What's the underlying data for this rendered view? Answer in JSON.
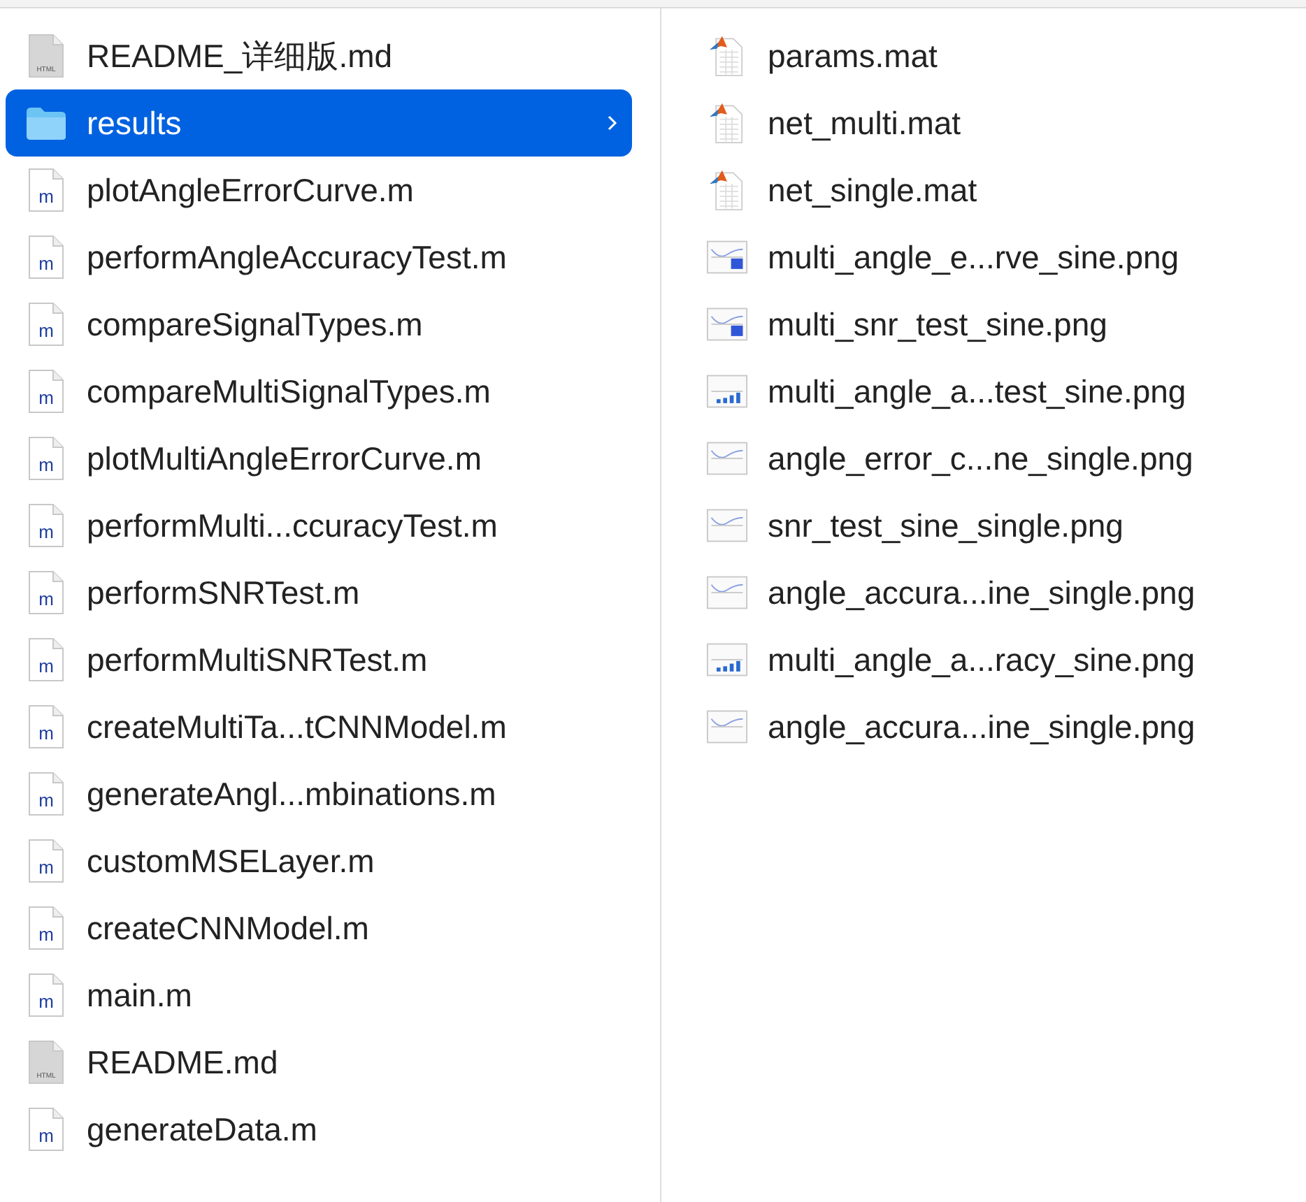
{
  "columns": [
    {
      "items": [
        {
          "name": "README_详细版.md",
          "kind": "html",
          "icon_label": "HTML",
          "selected": false
        },
        {
          "name": "results",
          "kind": "folder",
          "selected": true,
          "expandable": true
        },
        {
          "name": "plotAngleErrorCurve.m",
          "kind": "m",
          "icon_label": "m",
          "selected": false
        },
        {
          "name": "performAngleAccuracyTest.m",
          "kind": "m",
          "icon_label": "m",
          "selected": false
        },
        {
          "name": "compareSignalTypes.m",
          "kind": "m",
          "icon_label": "m",
          "selected": false
        },
        {
          "name": "compareMultiSignalTypes.m",
          "kind": "m",
          "icon_label": "m",
          "selected": false
        },
        {
          "name": "plotMultiAngleErrorCurve.m",
          "kind": "m",
          "icon_label": "m",
          "selected": false
        },
        {
          "name": "performMulti...ccuracyTest.m",
          "kind": "m",
          "icon_label": "m",
          "selected": false
        },
        {
          "name": "performSNRTest.m",
          "kind": "m",
          "icon_label": "m",
          "selected": false
        },
        {
          "name": "performMultiSNRTest.m",
          "kind": "m",
          "icon_label": "m",
          "selected": false
        },
        {
          "name": "createMultiTa...tCNNModel.m",
          "kind": "m",
          "icon_label": "m",
          "selected": false
        },
        {
          "name": "generateAngl...mbinations.m",
          "kind": "m",
          "icon_label": "m",
          "selected": false
        },
        {
          "name": "customMSELayer.m",
          "kind": "m",
          "icon_label": "m",
          "selected": false
        },
        {
          "name": "createCNNModel.m",
          "kind": "m",
          "icon_label": "m",
          "selected": false
        },
        {
          "name": "main.m",
          "kind": "m",
          "icon_label": "m",
          "selected": false
        },
        {
          "name": "README.md",
          "kind": "html",
          "icon_label": "HTML",
          "selected": false
        },
        {
          "name": "generateData.m",
          "kind": "m",
          "icon_label": "m",
          "selected": false
        }
      ]
    },
    {
      "items": [
        {
          "name": "params.mat",
          "kind": "mat",
          "selected": false
        },
        {
          "name": "net_multi.mat",
          "kind": "mat",
          "selected": false
        },
        {
          "name": "net_single.mat",
          "kind": "mat",
          "selected": false
        },
        {
          "name": "multi_angle_e...rve_sine.png",
          "kind": "heatmap",
          "selected": false
        },
        {
          "name": "multi_snr_test_sine.png",
          "kind": "heatmap",
          "selected": false
        },
        {
          "name": "multi_angle_a...test_sine.png",
          "kind": "bars",
          "selected": false
        },
        {
          "name": "angle_error_c...ne_single.png",
          "kind": "plot",
          "selected": false
        },
        {
          "name": "snr_test_sine_single.png",
          "kind": "plot",
          "selected": false
        },
        {
          "name": "angle_accura...ine_single.png",
          "kind": "plot",
          "selected": false
        },
        {
          "name": "multi_angle_a...racy_sine.png",
          "kind": "bars",
          "selected": false
        },
        {
          "name": "angle_accura...ine_single.png",
          "kind": "plot",
          "selected": false
        }
      ]
    }
  ]
}
